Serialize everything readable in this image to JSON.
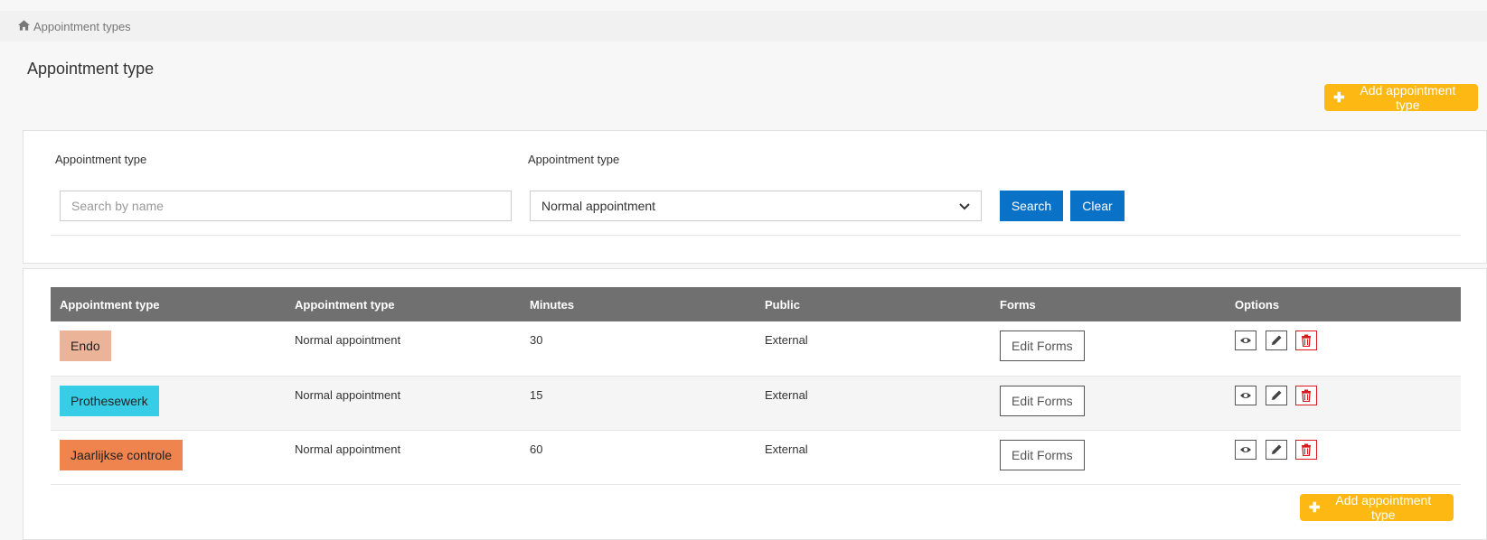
{
  "breadcrumb": {
    "icon": "home-icon",
    "label": "Appointment types"
  },
  "page": {
    "title": "Appointment type"
  },
  "actions": {
    "add_label": "Add appointment type",
    "accent": "#fdb813"
  },
  "filter": {
    "name_label": "Appointment type",
    "name_placeholder": "Search by name",
    "type_label": "Appointment type",
    "type_value": "Normal appointment",
    "search_label": "Search",
    "clear_label": "Clear",
    "button_color": "#0a72c6"
  },
  "table": {
    "headers": [
      "Appointment type",
      "Appointment type",
      "Minutes",
      "Public",
      "Forms",
      "Options"
    ],
    "rows": [
      {
        "name": "Endo",
        "color": "#ebb398",
        "type": "Normal appointment",
        "minutes": "30",
        "public": "External",
        "forms_label": "Edit Forms"
      },
      {
        "name": "Prothesewerk",
        "color": "#37cde6",
        "type": "Normal appointment",
        "minutes": "15",
        "public": "External",
        "forms_label": "Edit Forms"
      },
      {
        "name": "Jaarlijkse controle",
        "color": "#f0844f",
        "type": "Normal appointment",
        "minutes": "60",
        "public": "External",
        "forms_label": "Edit Forms"
      }
    ],
    "option_icons": [
      "eye-icon",
      "pencil-icon",
      "trash-icon"
    ]
  }
}
